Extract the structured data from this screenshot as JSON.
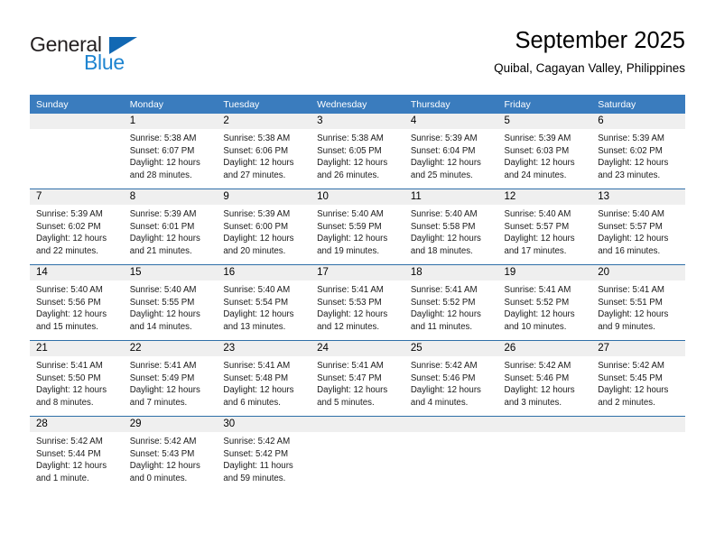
{
  "brand": {
    "name_top": "General",
    "name_bottom": "Blue",
    "accent_color": "#1e84d0",
    "triangle_color": "#1268b3"
  },
  "header": {
    "title": "September 2025",
    "subtitle": "Quibal, Cagayan Valley, Philippines"
  },
  "calendar": {
    "header_bg": "#3a7cbe",
    "daynum_bg": "#efefef",
    "weekday_headers": [
      "Sunday",
      "Monday",
      "Tuesday",
      "Wednesday",
      "Thursday",
      "Friday",
      "Saturday"
    ],
    "weeks": [
      [
        {
          "day": "",
          "lines": []
        },
        {
          "day": "1",
          "lines": [
            "Sunrise: 5:38 AM",
            "Sunset: 6:07 PM",
            "Daylight: 12 hours",
            "and 28 minutes."
          ]
        },
        {
          "day": "2",
          "lines": [
            "Sunrise: 5:38 AM",
            "Sunset: 6:06 PM",
            "Daylight: 12 hours",
            "and 27 minutes."
          ]
        },
        {
          "day": "3",
          "lines": [
            "Sunrise: 5:38 AM",
            "Sunset: 6:05 PM",
            "Daylight: 12 hours",
            "and 26 minutes."
          ]
        },
        {
          "day": "4",
          "lines": [
            "Sunrise: 5:39 AM",
            "Sunset: 6:04 PM",
            "Daylight: 12 hours",
            "and 25 minutes."
          ]
        },
        {
          "day": "5",
          "lines": [
            "Sunrise: 5:39 AM",
            "Sunset: 6:03 PM",
            "Daylight: 12 hours",
            "and 24 minutes."
          ]
        },
        {
          "day": "6",
          "lines": [
            "Sunrise: 5:39 AM",
            "Sunset: 6:02 PM",
            "Daylight: 12 hours",
            "and 23 minutes."
          ]
        }
      ],
      [
        {
          "day": "7",
          "lines": [
            "Sunrise: 5:39 AM",
            "Sunset: 6:02 PM",
            "Daylight: 12 hours",
            "and 22 minutes."
          ]
        },
        {
          "day": "8",
          "lines": [
            "Sunrise: 5:39 AM",
            "Sunset: 6:01 PM",
            "Daylight: 12 hours",
            "and 21 minutes."
          ]
        },
        {
          "day": "9",
          "lines": [
            "Sunrise: 5:39 AM",
            "Sunset: 6:00 PM",
            "Daylight: 12 hours",
            "and 20 minutes."
          ]
        },
        {
          "day": "10",
          "lines": [
            "Sunrise: 5:40 AM",
            "Sunset: 5:59 PM",
            "Daylight: 12 hours",
            "and 19 minutes."
          ]
        },
        {
          "day": "11",
          "lines": [
            "Sunrise: 5:40 AM",
            "Sunset: 5:58 PM",
            "Daylight: 12 hours",
            "and 18 minutes."
          ]
        },
        {
          "day": "12",
          "lines": [
            "Sunrise: 5:40 AM",
            "Sunset: 5:57 PM",
            "Daylight: 12 hours",
            "and 17 minutes."
          ]
        },
        {
          "day": "13",
          "lines": [
            "Sunrise: 5:40 AM",
            "Sunset: 5:57 PM",
            "Daylight: 12 hours",
            "and 16 minutes."
          ]
        }
      ],
      [
        {
          "day": "14",
          "lines": [
            "Sunrise: 5:40 AM",
            "Sunset: 5:56 PM",
            "Daylight: 12 hours",
            "and 15 minutes."
          ]
        },
        {
          "day": "15",
          "lines": [
            "Sunrise: 5:40 AM",
            "Sunset: 5:55 PM",
            "Daylight: 12 hours",
            "and 14 minutes."
          ]
        },
        {
          "day": "16",
          "lines": [
            "Sunrise: 5:40 AM",
            "Sunset: 5:54 PM",
            "Daylight: 12 hours",
            "and 13 minutes."
          ]
        },
        {
          "day": "17",
          "lines": [
            "Sunrise: 5:41 AM",
            "Sunset: 5:53 PM",
            "Daylight: 12 hours",
            "and 12 minutes."
          ]
        },
        {
          "day": "18",
          "lines": [
            "Sunrise: 5:41 AM",
            "Sunset: 5:52 PM",
            "Daylight: 12 hours",
            "and 11 minutes."
          ]
        },
        {
          "day": "19",
          "lines": [
            "Sunrise: 5:41 AM",
            "Sunset: 5:52 PM",
            "Daylight: 12 hours",
            "and 10 minutes."
          ]
        },
        {
          "day": "20",
          "lines": [
            "Sunrise: 5:41 AM",
            "Sunset: 5:51 PM",
            "Daylight: 12 hours",
            "and 9 minutes."
          ]
        }
      ],
      [
        {
          "day": "21",
          "lines": [
            "Sunrise: 5:41 AM",
            "Sunset: 5:50 PM",
            "Daylight: 12 hours",
            "and 8 minutes."
          ]
        },
        {
          "day": "22",
          "lines": [
            "Sunrise: 5:41 AM",
            "Sunset: 5:49 PM",
            "Daylight: 12 hours",
            "and 7 minutes."
          ]
        },
        {
          "day": "23",
          "lines": [
            "Sunrise: 5:41 AM",
            "Sunset: 5:48 PM",
            "Daylight: 12 hours",
            "and 6 minutes."
          ]
        },
        {
          "day": "24",
          "lines": [
            "Sunrise: 5:41 AM",
            "Sunset: 5:47 PM",
            "Daylight: 12 hours",
            "and 5 minutes."
          ]
        },
        {
          "day": "25",
          "lines": [
            "Sunrise: 5:42 AM",
            "Sunset: 5:46 PM",
            "Daylight: 12 hours",
            "and 4 minutes."
          ]
        },
        {
          "day": "26",
          "lines": [
            "Sunrise: 5:42 AM",
            "Sunset: 5:46 PM",
            "Daylight: 12 hours",
            "and 3 minutes."
          ]
        },
        {
          "day": "27",
          "lines": [
            "Sunrise: 5:42 AM",
            "Sunset: 5:45 PM",
            "Daylight: 12 hours",
            "and 2 minutes."
          ]
        }
      ],
      [
        {
          "day": "28",
          "lines": [
            "Sunrise: 5:42 AM",
            "Sunset: 5:44 PM",
            "Daylight: 12 hours",
            "and 1 minute."
          ]
        },
        {
          "day": "29",
          "lines": [
            "Sunrise: 5:42 AM",
            "Sunset: 5:43 PM",
            "Daylight: 12 hours",
            "and 0 minutes."
          ]
        },
        {
          "day": "30",
          "lines": [
            "Sunrise: 5:42 AM",
            "Sunset: 5:42 PM",
            "Daylight: 11 hours",
            "and 59 minutes."
          ]
        },
        {
          "day": "",
          "lines": []
        },
        {
          "day": "",
          "lines": []
        },
        {
          "day": "",
          "lines": []
        },
        {
          "day": "",
          "lines": []
        }
      ]
    ]
  }
}
